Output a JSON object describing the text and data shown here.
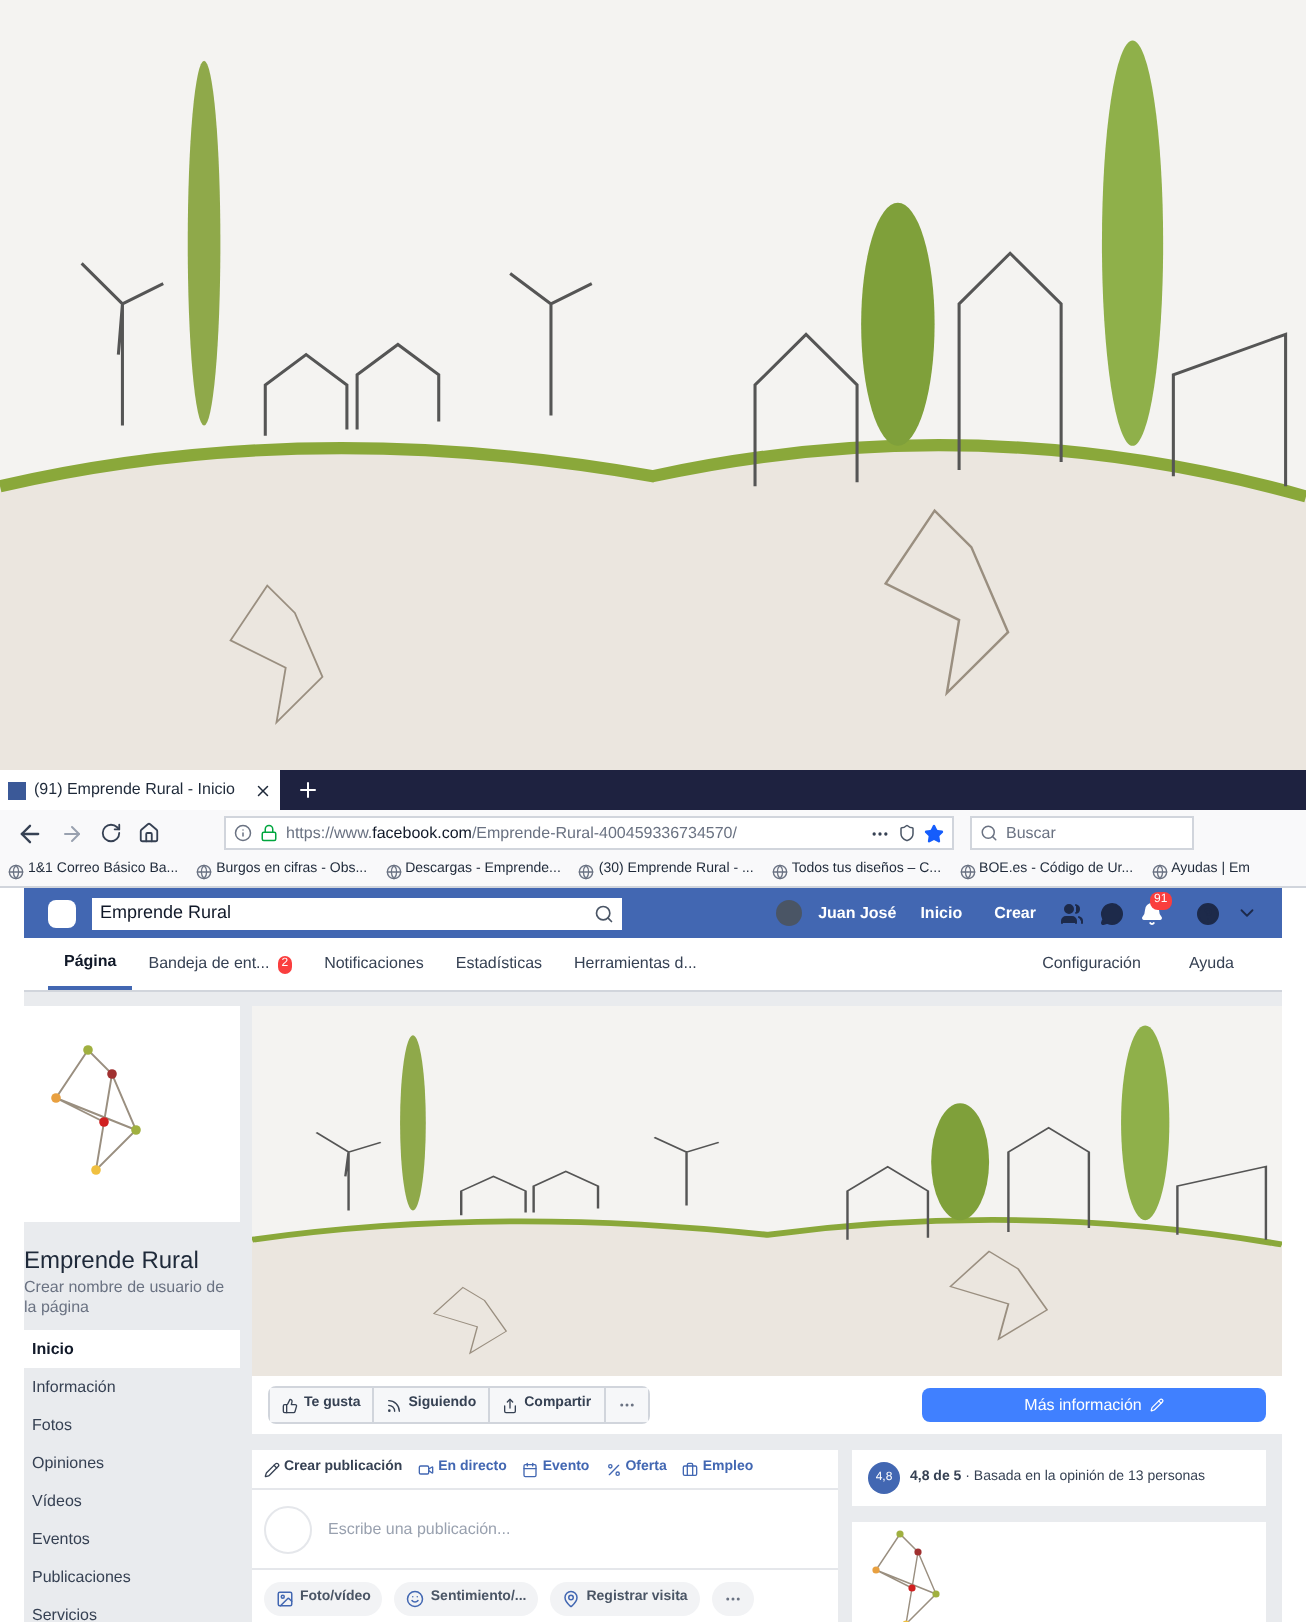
{
  "browser": {
    "tab": {
      "title": "(91) Emprende Rural - Inicio"
    },
    "address": {
      "prefix": "https://www.",
      "domain": "facebook.com",
      "path": "/Emprende-Rural-400459336734570/"
    },
    "search": {
      "placeholder": "Buscar"
    },
    "bookmarks": [
      {
        "label": "1&1 Correo Básico Ba..."
      },
      {
        "label": "Burgos en cifras - Obs..."
      },
      {
        "label": "Descargas - Emprende..."
      },
      {
        "label": "(30) Emprende Rural - ..."
      },
      {
        "label": "Todos tus diseños – C..."
      },
      {
        "label": "BOE.es - Código de Ur..."
      },
      {
        "label": "Ayudas | Em"
      }
    ]
  },
  "topbar": {
    "search_value": "Emprende Rural",
    "user": "Juan José",
    "links": [
      "Inicio",
      "Crear"
    ],
    "notifications": "91"
  },
  "page_tabs": [
    {
      "label": "Página",
      "selected": true
    },
    {
      "label": "Bandeja de ent...",
      "selected": false,
      "badge": "2"
    },
    {
      "label": "Notificaciones",
      "selected": false
    },
    {
      "label": "Estadísticas",
      "selected": false
    },
    {
      "label": "Herramientas d...",
      "selected": false
    }
  ],
  "page_tabs_right": [
    "Configuración",
    "Ayuda"
  ],
  "sidebar": {
    "name": "Emprende Rural",
    "username_link": "Crear nombre de usuario de la página",
    "items": [
      {
        "label": "Inicio",
        "selected": true
      },
      {
        "label": "Información",
        "selected": false
      },
      {
        "label": "Fotos",
        "selected": false
      },
      {
        "label": "Opiniones",
        "selected": false
      },
      {
        "label": "Vídeos",
        "selected": false
      },
      {
        "label": "Eventos",
        "selected": false
      },
      {
        "label": "Publicaciones",
        "selected": false
      },
      {
        "label": "Servicios",
        "selected": false
      }
    ]
  },
  "actions": [
    "Te gusta",
    "Siguiendo",
    "Compartir"
  ],
  "more_info": "Más información",
  "composer": {
    "tabs": [
      "Crear publicación",
      "En directo",
      "Evento",
      "Oferta",
      "Empleo"
    ],
    "placeholder": "Escribe una publicación...",
    "buttons": [
      "Foto/vídeo",
      "Sentimiento/...",
      "Registrar visita"
    ]
  },
  "rating": {
    "score": "4,8",
    "summary": "4,8 de 5",
    "text": " · Basada en la opinión de 13 personas"
  }
}
